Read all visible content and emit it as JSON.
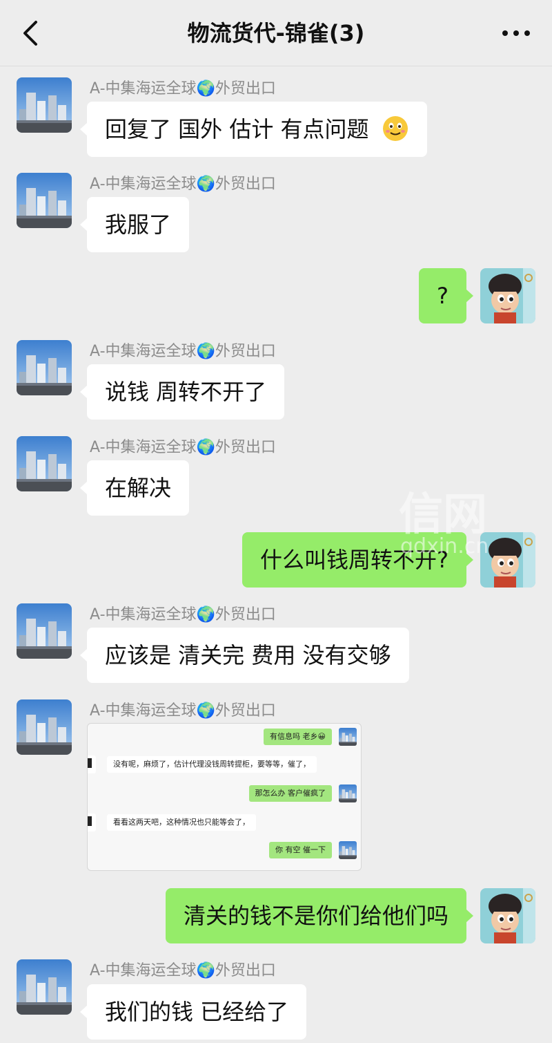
{
  "header": {
    "title": "物流货代-锦雀(3)",
    "back_icon": "chevron-left-icon",
    "more_icon": "ellipsis-icon"
  },
  "contact": {
    "name": "A-中集海运全球🌍外贸出口"
  },
  "messages": [
    {
      "from": "contact",
      "text": "回复了 国外 估计 有点问题",
      "emoji": "smiling-face-icon"
    },
    {
      "from": "contact",
      "text": "我服了"
    },
    {
      "from": "me",
      "text": "?"
    },
    {
      "from": "contact",
      "text": "说钱 周转不开了"
    },
    {
      "from": "contact",
      "text": "在解决"
    },
    {
      "from": "me",
      "text": "什么叫钱周转不开?"
    },
    {
      "from": "contact",
      "text": "应该是 清关完 费用 没有交够"
    },
    {
      "from": "contact",
      "type": "image"
    },
    {
      "from": "me",
      "text": "清关的钱不是你们给他们吗"
    },
    {
      "from": "contact",
      "text": "我们的钱 已经给了"
    }
  ],
  "screenshot": {
    "lines": [
      {
        "from": "me",
        "text": "有信息吗 老乡😀"
      },
      {
        "from": "other",
        "text": "没有呢，麻烦了，估计代理没钱周转提柜，要等等，催了，"
      },
      {
        "from": "me",
        "text": "那怎么办 客户催疯了"
      },
      {
        "from": "other",
        "text": "看看这两天吧，这种情况也只能等会了，"
      },
      {
        "from": "me",
        "text": "你 有空 催一下"
      }
    ]
  },
  "watermark": {
    "logo": "信网",
    "domain": "qdxin.cn"
  },
  "colors": {
    "background": "#ededed",
    "incoming_bubble": "#ffffff",
    "outgoing_bubble": "#95ec69",
    "sender_name": "#8c8c8c"
  }
}
